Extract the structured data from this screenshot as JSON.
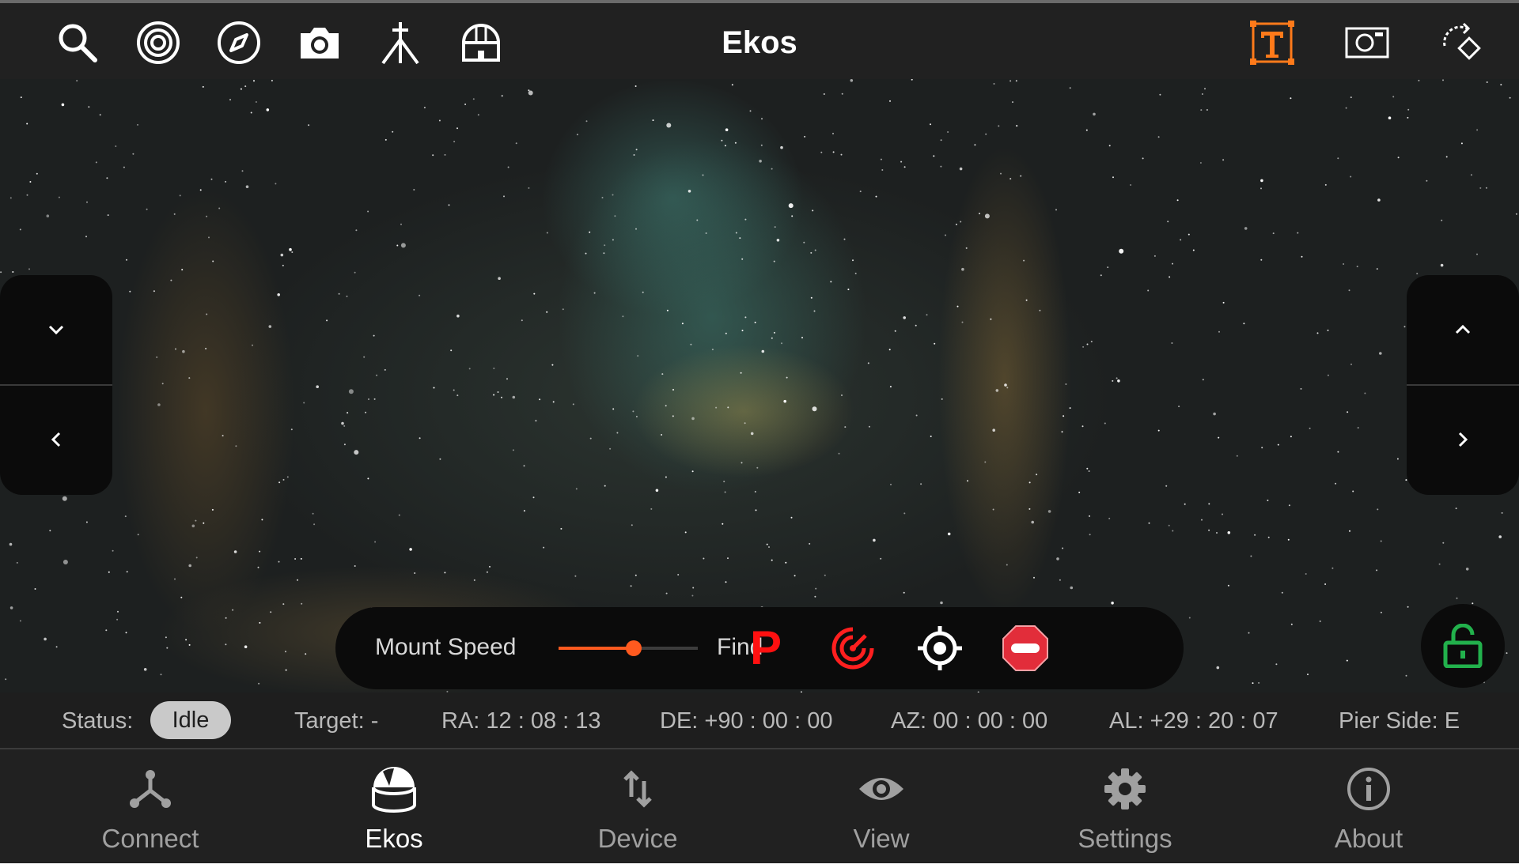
{
  "app": {
    "title": "Ekos"
  },
  "toolbar": {
    "left_icons": [
      "search-icon",
      "focus-target-icon",
      "compass-icon",
      "camera-icon",
      "telescope-mount-icon",
      "observatory-dome-icon"
    ],
    "right_icons": [
      "text-overlay-icon",
      "screenshot-icon",
      "rotate-view-icon"
    ],
    "accent_color": "#ff7a1a"
  },
  "motion_pad": {
    "left": [
      "chevron-down-icon",
      "chevron-left-icon"
    ],
    "right": [
      "chevron-up-icon",
      "chevron-right-icon"
    ]
  },
  "control_bar": {
    "speed_label": "Mount Speed",
    "speed_value": "Find",
    "speed_level": 0.54,
    "buttons": [
      "park-icon",
      "track-icon",
      "sync-target-icon",
      "stop-icon"
    ],
    "park_letter": "P",
    "danger_color": "#ff1f1f"
  },
  "lock": {
    "icon": "unlock-icon",
    "color": "#22b14c"
  },
  "status": {
    "label": "Status:",
    "value": "Idle",
    "target": "Target: -",
    "ra": "RA: 12 : 08 : 13",
    "de": "DE: +90 : 00 : 00",
    "az": "AZ: 00 : 00 : 00",
    "al": "AL: +29 : 20 : 07",
    "pier": "Pier Side: E"
  },
  "nav": {
    "items": [
      {
        "label": "Connect",
        "icon": "connect-icon",
        "active": false
      },
      {
        "label": "Ekos",
        "icon": "dome-icon",
        "active": true
      },
      {
        "label": "Device",
        "icon": "device-icon",
        "active": false
      },
      {
        "label": "View",
        "icon": "eye-icon",
        "active": false
      },
      {
        "label": "Settings",
        "icon": "gear-icon",
        "active": false
      },
      {
        "label": "About",
        "icon": "info-icon",
        "active": false
      }
    ]
  }
}
